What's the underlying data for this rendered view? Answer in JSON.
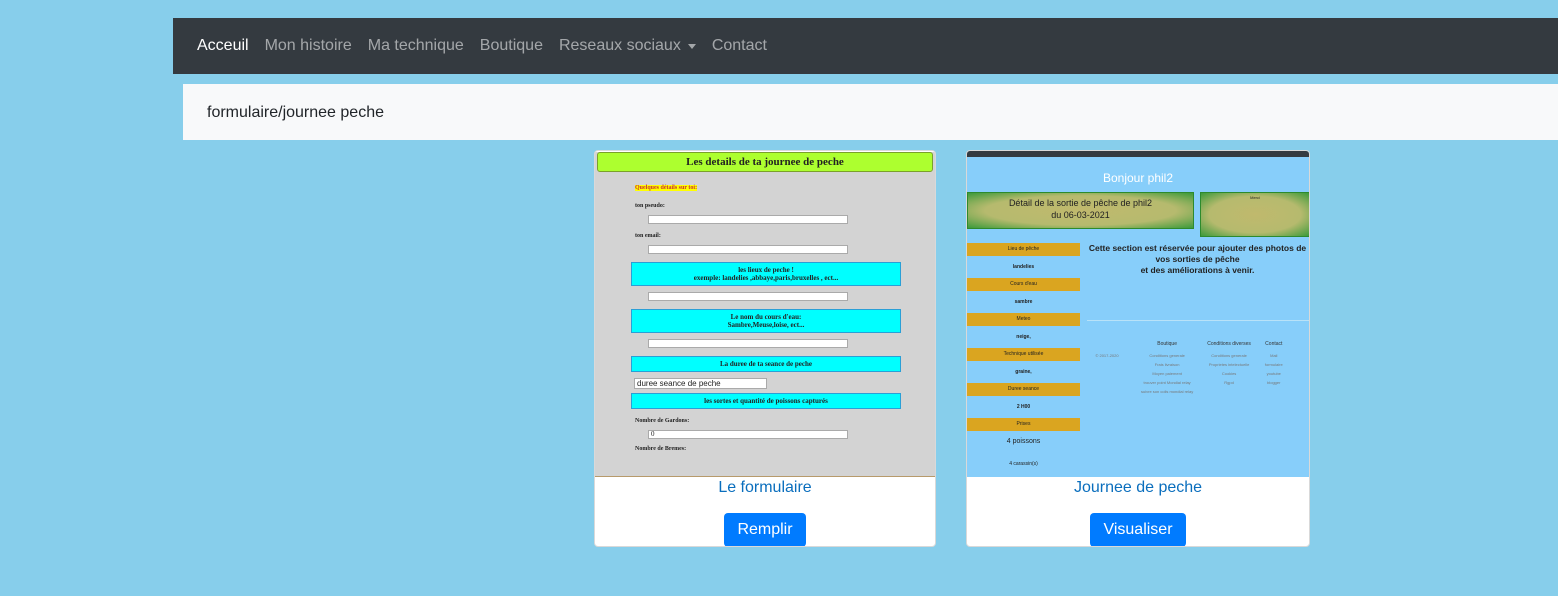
{
  "nav": {
    "items": [
      "Acceuil",
      "Mon histoire",
      "Ma technique",
      "Boutique",
      "Reseaux sociaux",
      "Contact"
    ]
  },
  "breadcrumb": "formulaire/journee peche",
  "cards": [
    {
      "title": "Le formulaire",
      "button": "Remplir",
      "shot": {
        "header": "Les details de ta journee de peche",
        "intro": "Quelques détails sur toi:",
        "pseudo": "ton pseudo:",
        "email": "ton email:",
        "lieux1": "les lieux de peche !",
        "lieux2": "exemple: landelies ,abbaye,paris,bruxelles , ect...",
        "cours1": "Le nom du cours d'eau:",
        "cours2": "Sambre,Meuse,loise, ect...",
        "duree": "La duree de ta seance de peche",
        "duree_select": "duree seance de peche",
        "sortes": "les sortes et quantité de poissons capturés",
        "gardons": "Nombre de Gardons:",
        "gardons_val": "0",
        "bremes": "Nombre de Bremes:"
      }
    },
    {
      "title": "Journee de peche",
      "button": "Visualiser",
      "shot": {
        "hello": "Bonjour phil2",
        "detail1": "Détail de la sortie de pêche de   phil2",
        "detail2": "du   06-03-2021",
        "note": "Merci",
        "rows": [
          {
            "k": "Lieu de pêche",
            "v": "landelies"
          },
          {
            "k": "Cours d'eau",
            "v": "sambre"
          },
          {
            "k": "Meteo",
            "v": "neige,"
          },
          {
            "k": "Technique utilisée",
            "v": "graine,"
          },
          {
            "k": "Duree seance",
            "v": "2 H00"
          },
          {
            "k": "Prises",
            "v": "4 poissons"
          }
        ],
        "extra": "4 carassin(s)",
        "msg1": "Cette section est réservée pour ajouter des photos de vos sorties de pêche",
        "msg2": "et des améliorations à venir.",
        "copyright": "© 2017-2020",
        "footer": [
          {
            "h": "Boutique",
            "items": [
              "Conditions generale",
              "Frais livraison",
              "Moyen paiement",
              "trouver point Mondial relay",
              "suivre son colis mondial relay"
            ]
          },
          {
            "h": "Conditions diverses",
            "items": [
              "Conditions generale",
              "Proprietes intelectuelle",
              "Cookies",
              "Rgpd"
            ]
          },
          {
            "h": "Contact",
            "items": [
              "Mail",
              "formulaire",
              "youtube",
              "blogger"
            ]
          }
        ]
      }
    }
  ]
}
